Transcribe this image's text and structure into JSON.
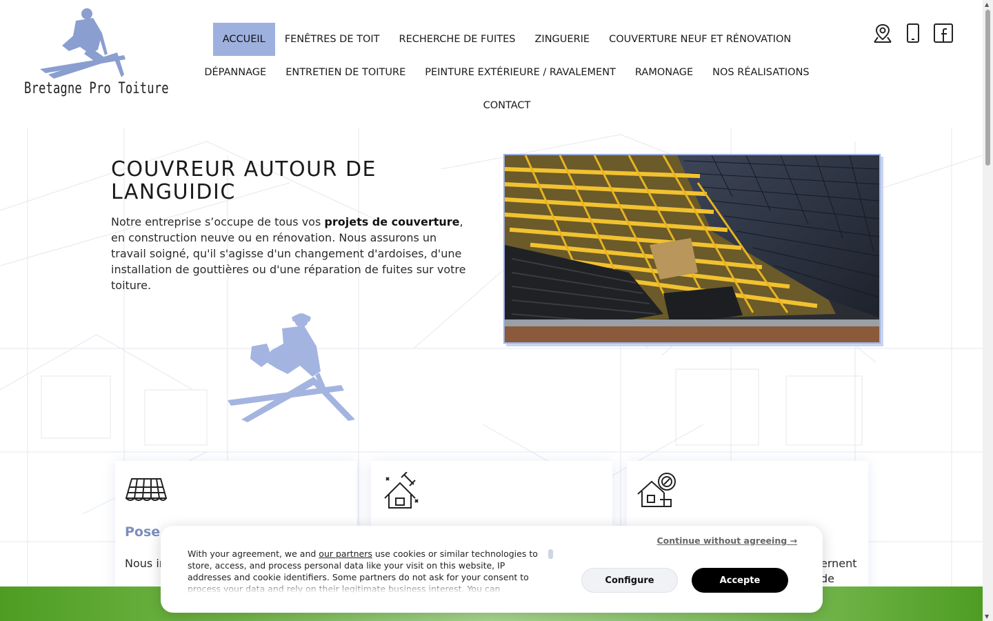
{
  "brand": {
    "name": "Bretagne Pro Toiture",
    "accent": "#9eb0de"
  },
  "nav": {
    "row1": [
      "ACCUEIL",
      "FENÊTRES DE TOIT",
      "RECHERCHE DE FUITES",
      "ZINGUERIE",
      "COUVERTURE NEUF ET RÉNOVATION"
    ],
    "row2": [
      "DÉPANNAGE",
      "ENTRETIEN DE TOITURE",
      "PEINTURE EXTÉRIEURE / RAVALEMENT",
      "RAMONAGE",
      "NOS RÉALISATIONS"
    ],
    "row3": [
      "CONTACT"
    ],
    "active": "ACCUEIL"
  },
  "header_icons": [
    "location-pin-icon",
    "phone-icon",
    "facebook-icon"
  ],
  "hero": {
    "title_line1": "COUVREUR AUTOUR DE",
    "title_line2": "LANGUIDIC",
    "text_before": "Notre entreprise s’occupe de tous vos ",
    "text_strong": "projets de couverture",
    "text_after": ", en construction neuve ou en rénovation. Nous assurons un travail soigné, qu'il s'agisse d'un changement d'ardoises, d'une installation de gouttières ou d'une réparation de fuites sur votre toiture."
  },
  "cards": [
    {
      "icon": "roof-tiles-icon",
      "title": "Pose",
      "text": "Nous in amélic"
    },
    {
      "icon": "house-repair-icon",
      "title": "",
      "text": ""
    },
    {
      "icon": "house-search-icon",
      "title": "",
      "text": ""
    }
  ],
  "card3_visible_text": {
    "line1": "ernent",
    "line2": "de"
  },
  "cookie": {
    "text_1": "With your agreement, we and ",
    "link": "our partners",
    "text_2": " use cookies or similar technologies to store, access, and process personal data like your visit on this website, IP addresses and cookie identifiers. Some partners do not ask for your consent to process your data and rely on their legitimate business interest. You can",
    "continue": "Continue without agreeing →",
    "configure": "Configure",
    "accept": "Accepte"
  },
  "colors": {
    "green_band": "#74b84a",
    "accept_bg": "#000000"
  }
}
